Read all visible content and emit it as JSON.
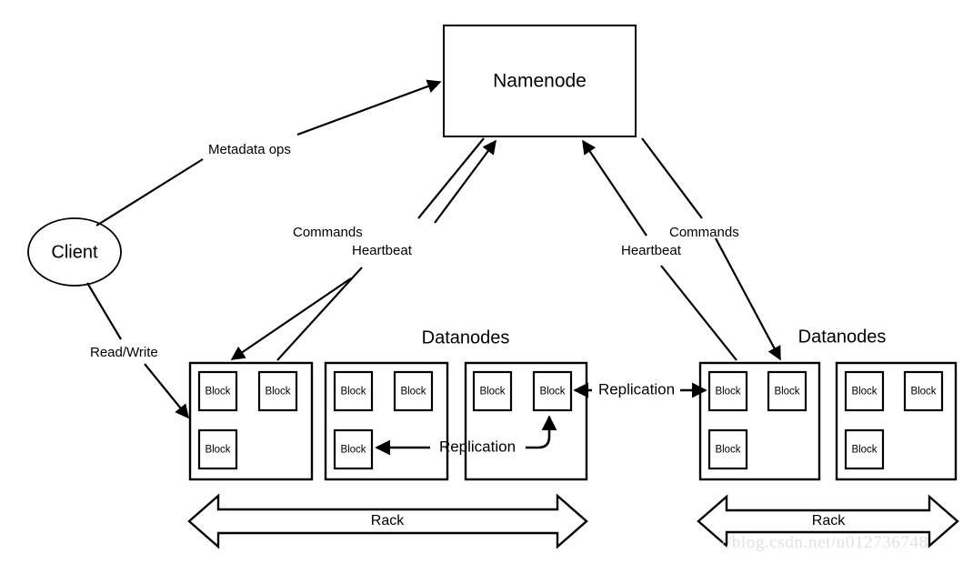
{
  "diagram": {
    "title_node": "Namenode",
    "client_node": "Client",
    "group_label_left": "Datanodes",
    "group_label_right": "Datanodes",
    "rack_label_left": "Rack",
    "rack_label_right": "Rack",
    "block_label": "Block",
    "edges": {
      "metadata_ops": "Metadata ops",
      "read_write": "Read/Write",
      "commands_left": "Commands",
      "heartbeat_left": "Heartbeat",
      "commands_right": "Commands",
      "heartbeat_right": "Heartbeat",
      "replication_upper": "Replication",
      "replication_lower": "Replication"
    },
    "blocks": {
      "dn1": [
        "Block",
        "Block",
        "Block"
      ],
      "dn2": [
        "Block",
        "Block",
        "Block"
      ],
      "dn3": [
        "Block",
        "Block"
      ],
      "dn4": [
        "Block",
        "Block",
        "Block"
      ],
      "dn5": [
        "Block",
        "Block",
        "Block"
      ]
    },
    "colors": {
      "stroke": "#000000",
      "fill": "#ffffff",
      "watermark": "#e2e2e2"
    }
  },
  "watermark": "//blog.csdn.net/u012736748"
}
